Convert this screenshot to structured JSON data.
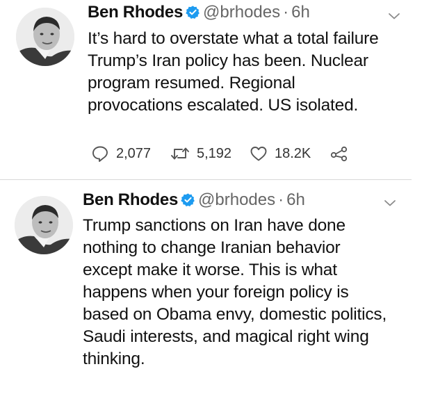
{
  "tweets": [
    {
      "author_name": "Ben Rhodes",
      "handle": "@brhodes",
      "separator": "·",
      "time": "6h",
      "verified": true,
      "lines": [
        "It’s hard to overstate what a total failure",
        "Trump’s Iran policy has been. Nuclear",
        "program resumed. Regional",
        "provocations escalated. US isolated."
      ],
      "stats": {
        "replies": "2,077",
        "retweets": "5,192",
        "likes": "18.2K"
      }
    },
    {
      "author_name": "Ben Rhodes",
      "handle": "@brhodes",
      "separator": "·",
      "time": "6h",
      "verified": true,
      "lines": [
        "Trump sanctions on Iran have done",
        "nothing to change Iranian behavior",
        "except make it worse. This is what",
        "happens when your foreign policy is",
        "based on Obama envy, domestic politics,",
        "Saudi interests, and magical right wing",
        "thinking."
      ]
    }
  ],
  "icons": {
    "verified": "verified-badge-icon",
    "caret": "chevron-down-icon",
    "reply": "reply-icon",
    "retweet": "retweet-icon",
    "like": "heart-icon",
    "share": "share-icon"
  },
  "colors": {
    "verified": "#1d9bf0",
    "muted_text": "#666666",
    "divider": "#d8d8d8"
  }
}
